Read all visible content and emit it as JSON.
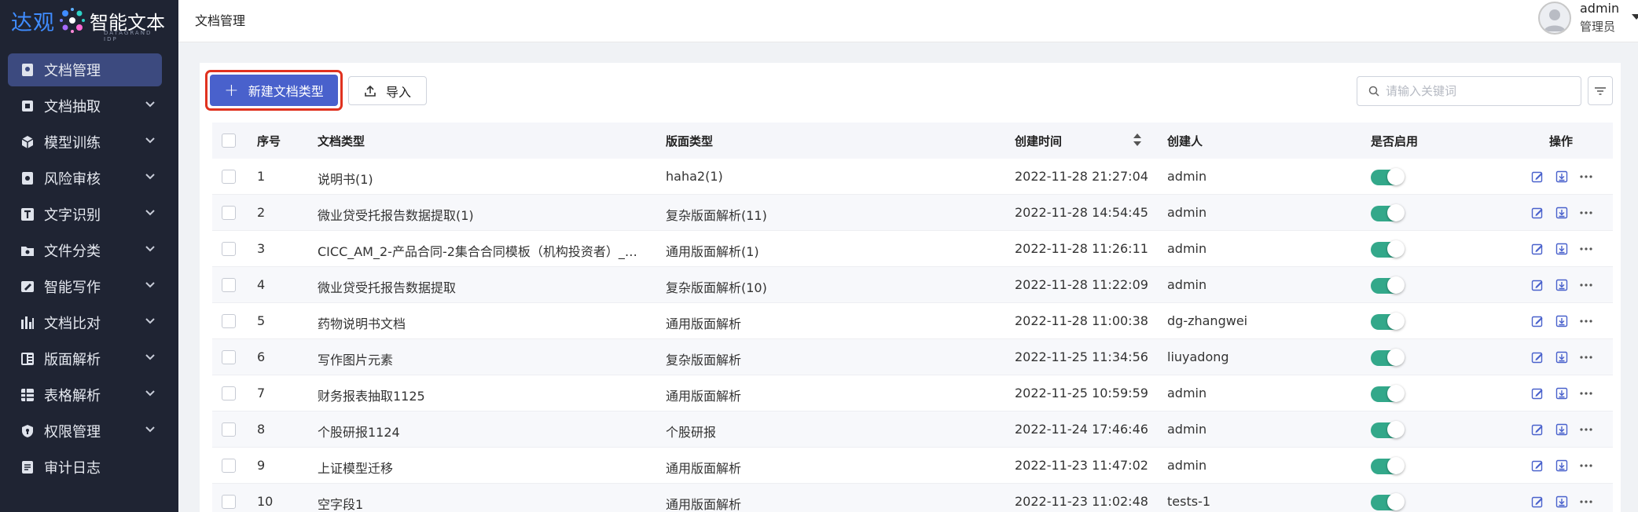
{
  "logo": {
    "brand_cn": "达观",
    "product": "智能文本",
    "subtitle": "DATAGRAND IDP"
  },
  "sidebar": {
    "items": [
      {
        "label": "文档管理",
        "icon": "document-manage-icon",
        "active": true,
        "expandable": false
      },
      {
        "label": "文档抽取",
        "icon": "extract-icon",
        "active": false,
        "expandable": true
      },
      {
        "label": "模型训练",
        "icon": "cube-icon",
        "active": false,
        "expandable": true
      },
      {
        "label": "风险审核",
        "icon": "risk-review-icon",
        "active": false,
        "expandable": true
      },
      {
        "label": "文字识别",
        "icon": "text-recognition-icon",
        "active": false,
        "expandable": true
      },
      {
        "label": "文件分类",
        "icon": "folder-icon",
        "active": false,
        "expandable": true
      },
      {
        "label": "智能写作",
        "icon": "smart-writing-icon",
        "active": false,
        "expandable": true
      },
      {
        "label": "文档比对",
        "icon": "compare-icon",
        "active": false,
        "expandable": true
      },
      {
        "label": "版面解析",
        "icon": "layout-icon",
        "active": false,
        "expandable": true
      },
      {
        "label": "表格解析",
        "icon": "table-icon",
        "active": false,
        "expandable": true
      },
      {
        "label": "权限管理",
        "icon": "shield-icon",
        "active": false,
        "expandable": true
      },
      {
        "label": "审计日志",
        "icon": "log-icon",
        "active": false,
        "expandable": false
      }
    ]
  },
  "header": {
    "breadcrumb": "文档管理",
    "user_name": "admin",
    "user_role": "管理员"
  },
  "toolbar": {
    "new_label": "新建文档类型",
    "import_label": "导入",
    "search_placeholder": "请输入关键词"
  },
  "table": {
    "columns": [
      "序号",
      "文档类型",
      "版面类型",
      "创建时间",
      "创建人",
      "是否启用",
      "操作"
    ],
    "rows": [
      {
        "index": "1",
        "doc_type": "说明书(1)",
        "layout_type": "haha2(1)",
        "created": "2022-11-28 21:27:04",
        "creator": "admin",
        "enabled": true
      },
      {
        "index": "2",
        "doc_type": "微业贷受托报告数据提取(1)",
        "layout_type": "复杂版面解析(11)",
        "created": "2022-11-28 14:54:45",
        "creator": "admin",
        "enabled": true
      },
      {
        "index": "3",
        "doc_type": "CICC_AM_2-产品合同-2集合合同模板（机构投资者）_2...",
        "layout_type": "通用版面解析(1)",
        "created": "2022-11-28 11:26:11",
        "creator": "admin",
        "enabled": true
      },
      {
        "index": "4",
        "doc_type": "微业贷受托报告数据提取",
        "layout_type": "复杂版面解析(10)",
        "created": "2022-11-28 11:22:09",
        "creator": "admin",
        "enabled": true
      },
      {
        "index": "5",
        "doc_type": "药物说明书文档",
        "layout_type": "通用版面解析",
        "created": "2022-11-28 11:00:38",
        "creator": "dg-zhangwei",
        "enabled": true
      },
      {
        "index": "6",
        "doc_type": "写作图片元素",
        "layout_type": "复杂版面解析",
        "created": "2022-11-25 11:34:56",
        "creator": "liuyadong",
        "enabled": true
      },
      {
        "index": "7",
        "doc_type": "财务报表抽取1125",
        "layout_type": "通用版面解析",
        "created": "2022-11-25 10:59:59",
        "creator": "admin",
        "enabled": true
      },
      {
        "index": "8",
        "doc_type": "个股研报1124",
        "layout_type": "个股研报",
        "created": "2022-11-24 17:46:46",
        "creator": "admin",
        "enabled": true
      },
      {
        "index": "9",
        "doc_type": "上证模型迁移",
        "layout_type": "通用版面解析",
        "created": "2022-11-23 11:47:02",
        "creator": "admin",
        "enabled": true
      },
      {
        "index": "10",
        "doc_type": "空字段1",
        "layout_type": "通用版面解析",
        "created": "2022-11-23 11:02:48",
        "creator": "tests-1",
        "enabled": true
      }
    ],
    "actions": [
      "edit-icon",
      "download-icon",
      "more-icon"
    ]
  },
  "colors": {
    "sidebar_bg": "#1f2433",
    "sidebar_active": "#3c4a7f",
    "primary": "#4961cc",
    "toggle_on": "#33a88a",
    "highlight_border": "#e0321f"
  }
}
